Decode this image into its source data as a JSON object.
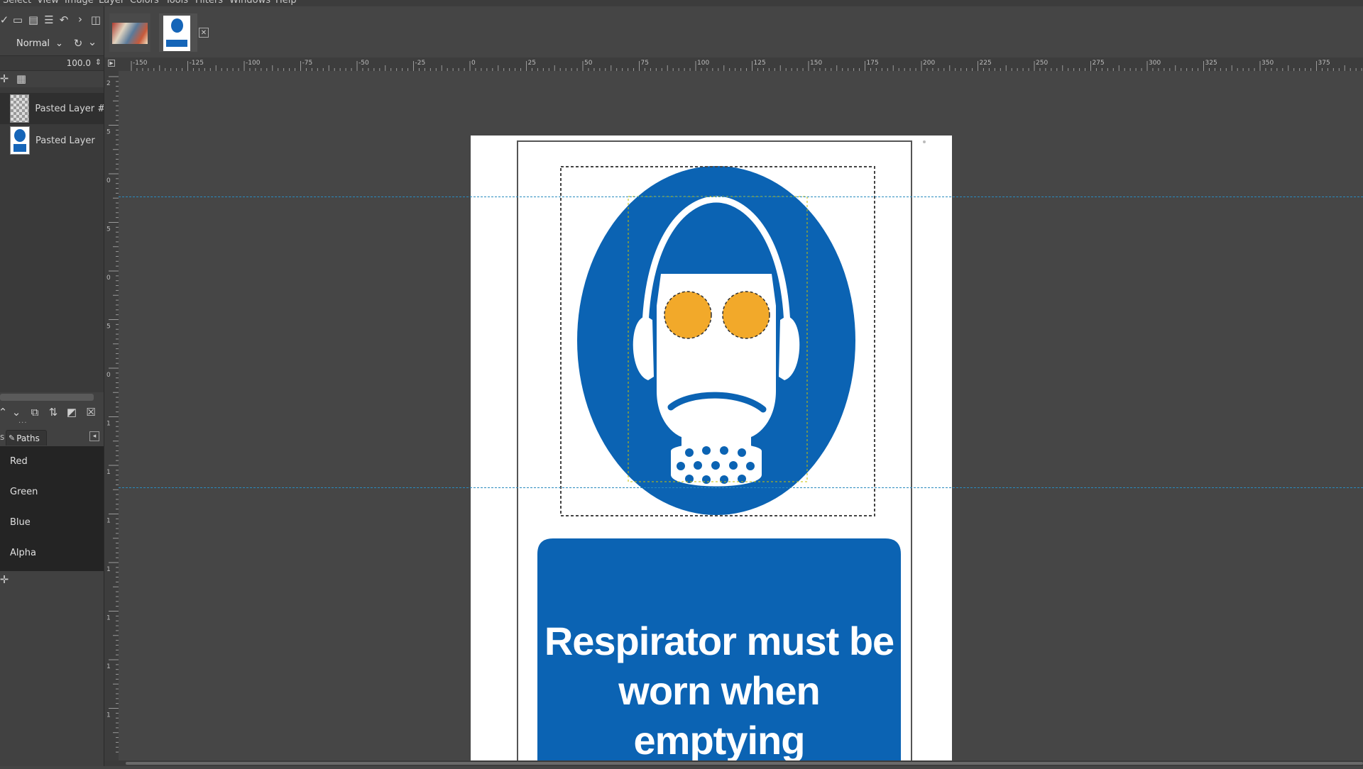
{
  "menubar": {
    "items": [
      "Select",
      "View",
      "Image",
      "Layer",
      "Colors",
      "Tools",
      "Filters",
      "Windows",
      "Help"
    ]
  },
  "tool_options": {
    "mode": "Normal",
    "opacity": "100.0"
  },
  "layers": [
    {
      "name": "Pasted Layer #",
      "thumb": "checker"
    },
    {
      "name": "Pasted Layer",
      "thumb": "sign"
    }
  ],
  "dock_tabs": {
    "active": "Paths"
  },
  "channels": [
    "Red",
    "Green",
    "Blue",
    "Alpha"
  ],
  "ruler": {
    "h_labels": [
      "-150",
      "-125",
      "-100",
      "-75",
      "-50",
      "-25",
      "0",
      "25",
      "50",
      "75",
      "100",
      "125",
      "150",
      "175",
      "200",
      "225",
      "250",
      "275",
      "300",
      "325",
      "350",
      "375"
    ],
    "v_labels": [
      "2",
      "5",
      "0",
      "5",
      "0",
      "5",
      "0",
      "1",
      "1",
      "1",
      "1",
      "1",
      "1",
      "1"
    ]
  },
  "sign": {
    "line1": "Respirator must be",
    "line2": "worn when emptying",
    "colors": {
      "blue": "#0b63b3",
      "orange": "#f2a92a",
      "white": "#ffffff"
    }
  },
  "colors": {
    "guide": "#2a8bbf",
    "canvas_bg": "#464646",
    "panel_bg": "#414141"
  }
}
